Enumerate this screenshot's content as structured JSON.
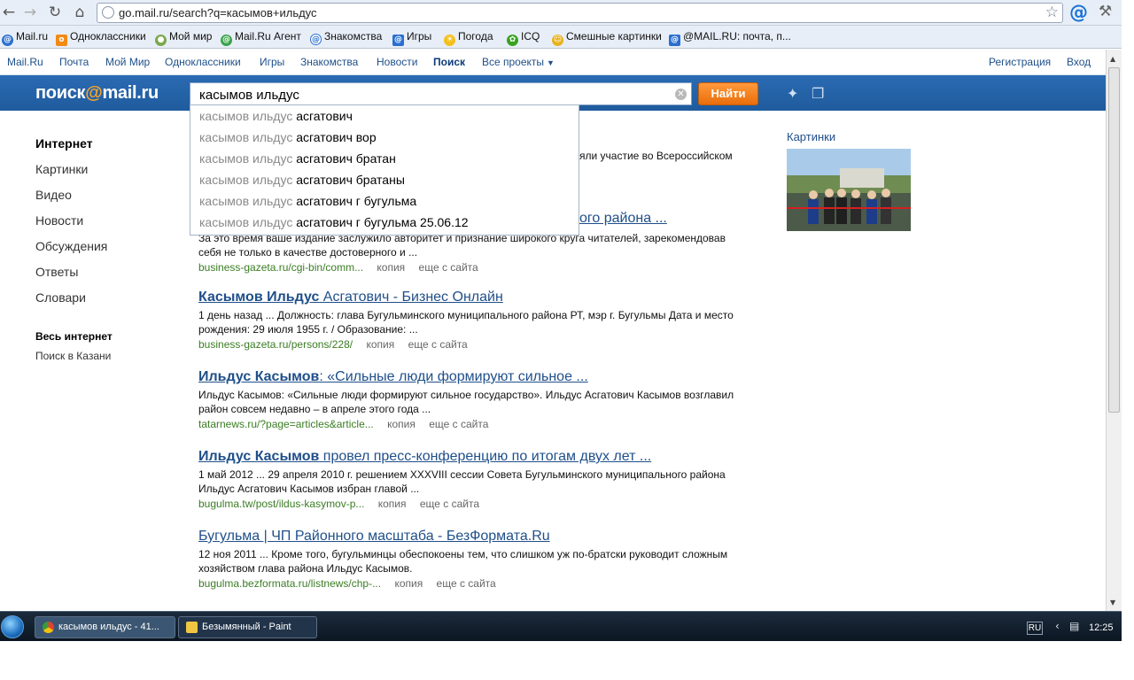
{
  "browser": {
    "url": "go.mail.ru/search?q=касымов+ильдус",
    "bookmarks": [
      "Mail.ru",
      "Одноклассники",
      "Мой мир",
      "Mail.Ru Агент",
      "Знакомства",
      "Игры",
      "Погода",
      "ICQ",
      "Смешные картинки",
      "@MAIL.RU: почта, п..."
    ]
  },
  "sitenav": {
    "left": [
      "Mail.Ru",
      "Почта",
      "Мой Мир",
      "Одноклассники",
      "Игры",
      "Знакомства",
      "Новости",
      "Поиск",
      "Все проекты"
    ],
    "register": "Регистрация",
    "login": "Вход"
  },
  "search": {
    "logo_pre": "поиск",
    "logo_at": "@",
    "logo_post": "mail.ru",
    "query": "касымов ильдус",
    "button": "Найти"
  },
  "suggest": {
    "typed": "касымов ильдус",
    "items": [
      "асгатович",
      "асгатович вор",
      "асгатович братан",
      "асгатович братаны",
      "асгатович г бугульма",
      "асгатович г бугульма 25.06.12"
    ]
  },
  "leftnav": {
    "items": [
      "Интернет",
      "Картинки",
      "Видео",
      "Новости",
      "Обсуждения",
      "Ответы",
      "Словари"
    ],
    "region_title": "Весь интернет",
    "region_item": "Поиск в Казани"
  },
  "partial": {
    "line": "яли участие во Всероссийском",
    "title": "ого района ..."
  },
  "results": [
    {
      "title_bold": "",
      "title_rest": "",
      "snippet": "За это время ваше издание заслужило авторитет и признание широкого круга читателей, зарекомендовав себя не только в качестве достоверного и ...",
      "link": "business-gazeta.ru/cgi-bin/comm...",
      "copy": "копия",
      "more": "еще с сайта"
    },
    {
      "title_bold": "Касымов Ильдус",
      "title_rest": " Асгатович - Бизнес Онлайн",
      "snippet": "1 день назад ... Должность: глава Бугульминского муниципального района РТ, мэр г. Бугульмы Дата и место рождения: 29 июля 1955 г. / Образование: ...",
      "link": "business-gazeta.ru/persons/228/",
      "copy": "копия",
      "more": "еще с сайта"
    },
    {
      "title_bold": "Ильдус Касымов",
      "title_rest": ": «Сильные люди формируют сильное ...",
      "snippet": "Ильдус Касымов: «Сильные люди формируют сильное государство». Ильдус Асгатович Касымов возглавил район совсем недавно – в апреле этого года ...",
      "link": "tatarnews.ru/?page=articles&article...",
      "copy": "копия",
      "more": "еще с сайта"
    },
    {
      "title_bold": "Ильдус Касымов",
      "title_rest": " провел пресс-конференцию по итогам двух лет ...",
      "snippet": "1 май 2012 ... 29 апреля 2010 г. решением XXXVIII сессии Совета Бугульминского муниципального района Ильдус Асгатович Касымов избран главой ...",
      "link": "bugulma.tw/post/ildus-kasymov-p...",
      "copy": "копия",
      "more": "еще с сайта"
    },
    {
      "title_bold": "",
      "title_rest": "Бугульма | ЧП Районного масштаба - БезФормата.Ru",
      "snippet": "12 ноя 2011 ... Кроме того, бугульминцы обеспокоены тем, что слишком уж по-братски руководит сложным хозяйством глава района Ильдус Касымов.",
      "link": "bugulma.bezformata.ru/listnews/chp-...",
      "copy": "копия",
      "more": "еще с сайта"
    }
  ],
  "images": {
    "label": "Картинки"
  },
  "taskbar": {
    "tasks": [
      "касымов ильдус - 41...",
      "Безымянный - Paint"
    ],
    "lang": "RU",
    "clock": "12:25"
  }
}
